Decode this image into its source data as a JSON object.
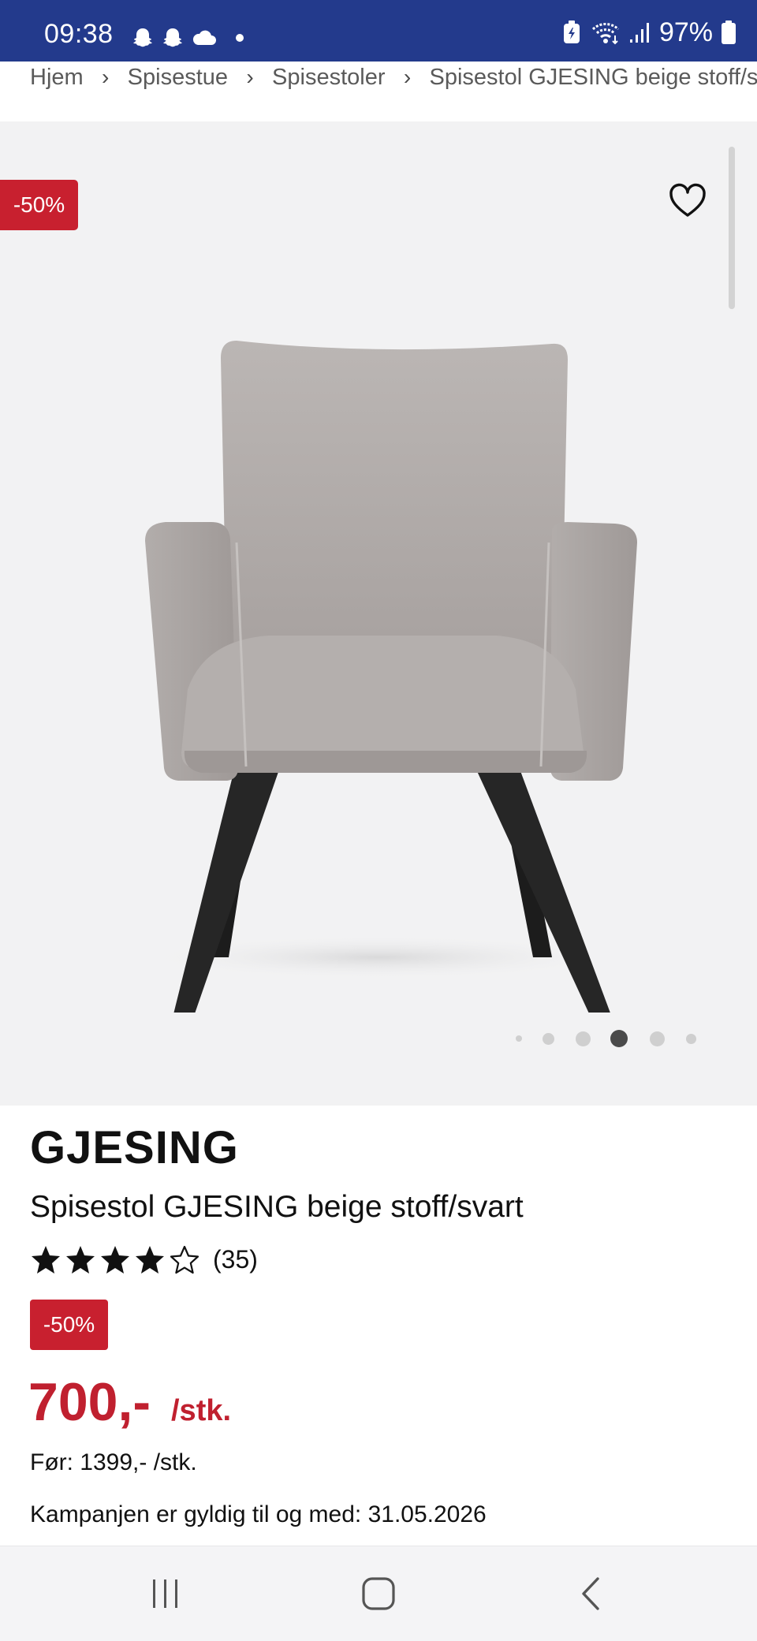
{
  "status_bar": {
    "time": "09:38",
    "battery": "97%",
    "notification_icons": [
      "snapchat-icon",
      "snapchat-icon",
      "cloud-icon",
      "dot-icon"
    ],
    "system_icons": [
      "battery-saver-icon",
      "wifi-icon",
      "signal-icon",
      "battery-icon"
    ]
  },
  "breadcrumb": {
    "items": [
      "Hjem",
      "Spisestue",
      "Spisestoler",
      "Spisestol GJESING beige stoff/svart"
    ],
    "separator": "›"
  },
  "gallery": {
    "discount_badge": "-50%",
    "wishlist_icon": "heart-outline-icon",
    "image_count": 6,
    "active_index": 3,
    "background_color": "#f2f2f3"
  },
  "product": {
    "brand": "GJESING",
    "name": "Spisestol GJESING beige stoff/svart",
    "rating": {
      "value": 4,
      "max": 5,
      "review_count": "(35)"
    },
    "discount_badge": "-50%",
    "price": "700,-",
    "price_unit": "/stk.",
    "previous_price": "Før: 1399,- /stk.",
    "campaign": "Kampanjen er gyldig til og med: 31.05.2026"
  },
  "colors": {
    "status_bar": "#233a8c",
    "discount_red": "#c8202f",
    "price_red": "#c0202f"
  },
  "nav_bar": {
    "buttons": [
      "recent-apps-icon",
      "home-icon",
      "back-icon"
    ]
  }
}
